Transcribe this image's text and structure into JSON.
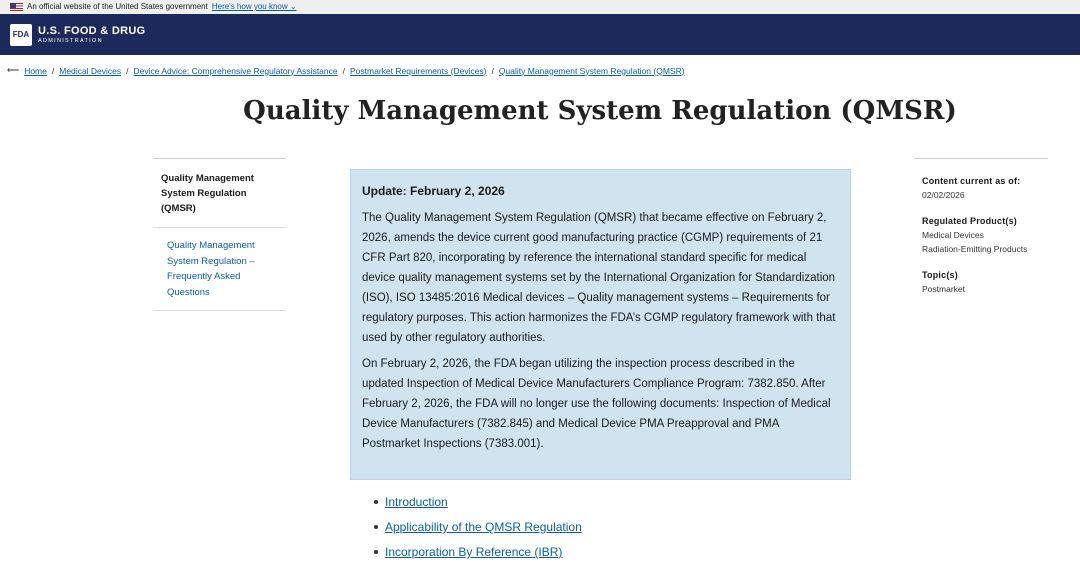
{
  "gov_banner": {
    "text": "An official website of the United States government",
    "link": "Here's how you know ⌄"
  },
  "header": {
    "logo_text": "FDA",
    "line1": "U.S. FOOD & DRUG",
    "line2": "ADMINISTRATION"
  },
  "breadcrumb": {
    "back_arrow": "⟵",
    "items": [
      "Home",
      "Medical Devices",
      "Device Advice: Comprehensive Regulatory Assistance",
      "Postmarket Requirements (Devices)",
      "Quality Management System Regulation (QMSR)"
    ],
    "separator": "/"
  },
  "page_title": "Quality Management System Regulation (QMSR)",
  "sidenav": {
    "current": "Quality Management System Regulation (QMSR)",
    "sub_items": [
      "Quality Management System Regulation – Frequently Asked Questions"
    ]
  },
  "callout": {
    "heading": "Update: February 2, 2026",
    "paragraphs": [
      "The Quality Management System Regulation (QMSR) that became effective on February 2, 2026, amends the device current good manufacturing practice (CGMP) requirements of 21 CFR Part 820, incorporating by reference the international standard specific for medical device quality management systems set by the International Organization for Standardization (ISO), ISO 13485:2016 Medical devices – Quality management systems – Requirements for regulatory purposes. This action harmonizes the FDA’s CGMP regulatory framework with that used by other regulatory authorities.",
      "On February 2, 2026, the FDA began utilizing the inspection process described in the updated Inspection of Medical Device Manufacturers Compliance Program: 7382.850. After February 2, 2026, the FDA will no longer use the following documents: Inspection of Medical Device Manufacturers (7382.845) and Medical Device PMA Preapproval and PMA Postmarket Inspections (7383.001)."
    ]
  },
  "toc": [
    "Introduction",
    "Applicability of the QMSR Regulation",
    "Incorporation By Reference (IBR)"
  ],
  "meta": {
    "content_current_label": "Content current as of:",
    "content_current_value": "02/02/2026",
    "regulated_label": "Regulated Product(s)",
    "regulated_values": [
      "Medical Devices",
      "Radiation-Emitting Products"
    ],
    "topics_label": "Topic(s)",
    "topics_values": [
      "Postmarket"
    ]
  }
}
